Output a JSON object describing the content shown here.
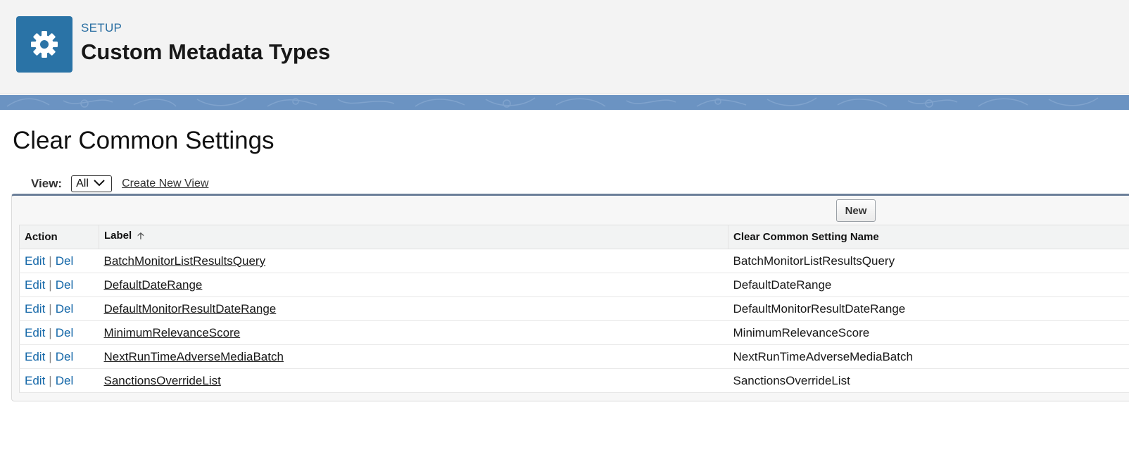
{
  "header": {
    "eyebrow": "SETUP",
    "title": "Custom Metadata Types",
    "icon": "gear-icon",
    "icon_color": "#2a73a6"
  },
  "page": {
    "title": "Clear Common Settings"
  },
  "view_bar": {
    "label": "View:",
    "selected": "All",
    "create_link": "Create New View"
  },
  "toolbar": {
    "new_label": "New"
  },
  "table": {
    "columns": [
      "Action",
      "Label",
      "Clear Common Setting Name"
    ],
    "edit_label": "Edit",
    "del_label": "Del",
    "rows": [
      {
        "label": "BatchMonitorListResultsQuery",
        "name": "BatchMonitorListResultsQuery"
      },
      {
        "label": "DefaultDateRange",
        "name": "DefaultDateRange"
      },
      {
        "label": "DefaultMonitorResultDateRange",
        "name": "DefaultMonitorResultDateRange"
      },
      {
        "label": "MinimumRelevanceScore",
        "name": "MinimumRelevanceScore"
      },
      {
        "label": "NextRunTimeAdverseMediaBatch",
        "name": "NextRunTimeAdverseMediaBatch"
      },
      {
        "label": "SanctionsOverrideList",
        "name": "SanctionsOverrideList"
      }
    ]
  },
  "colors": {
    "link": "#1467a8",
    "banner": "#6b93c2",
    "header_bg": "#f3f3f3"
  }
}
